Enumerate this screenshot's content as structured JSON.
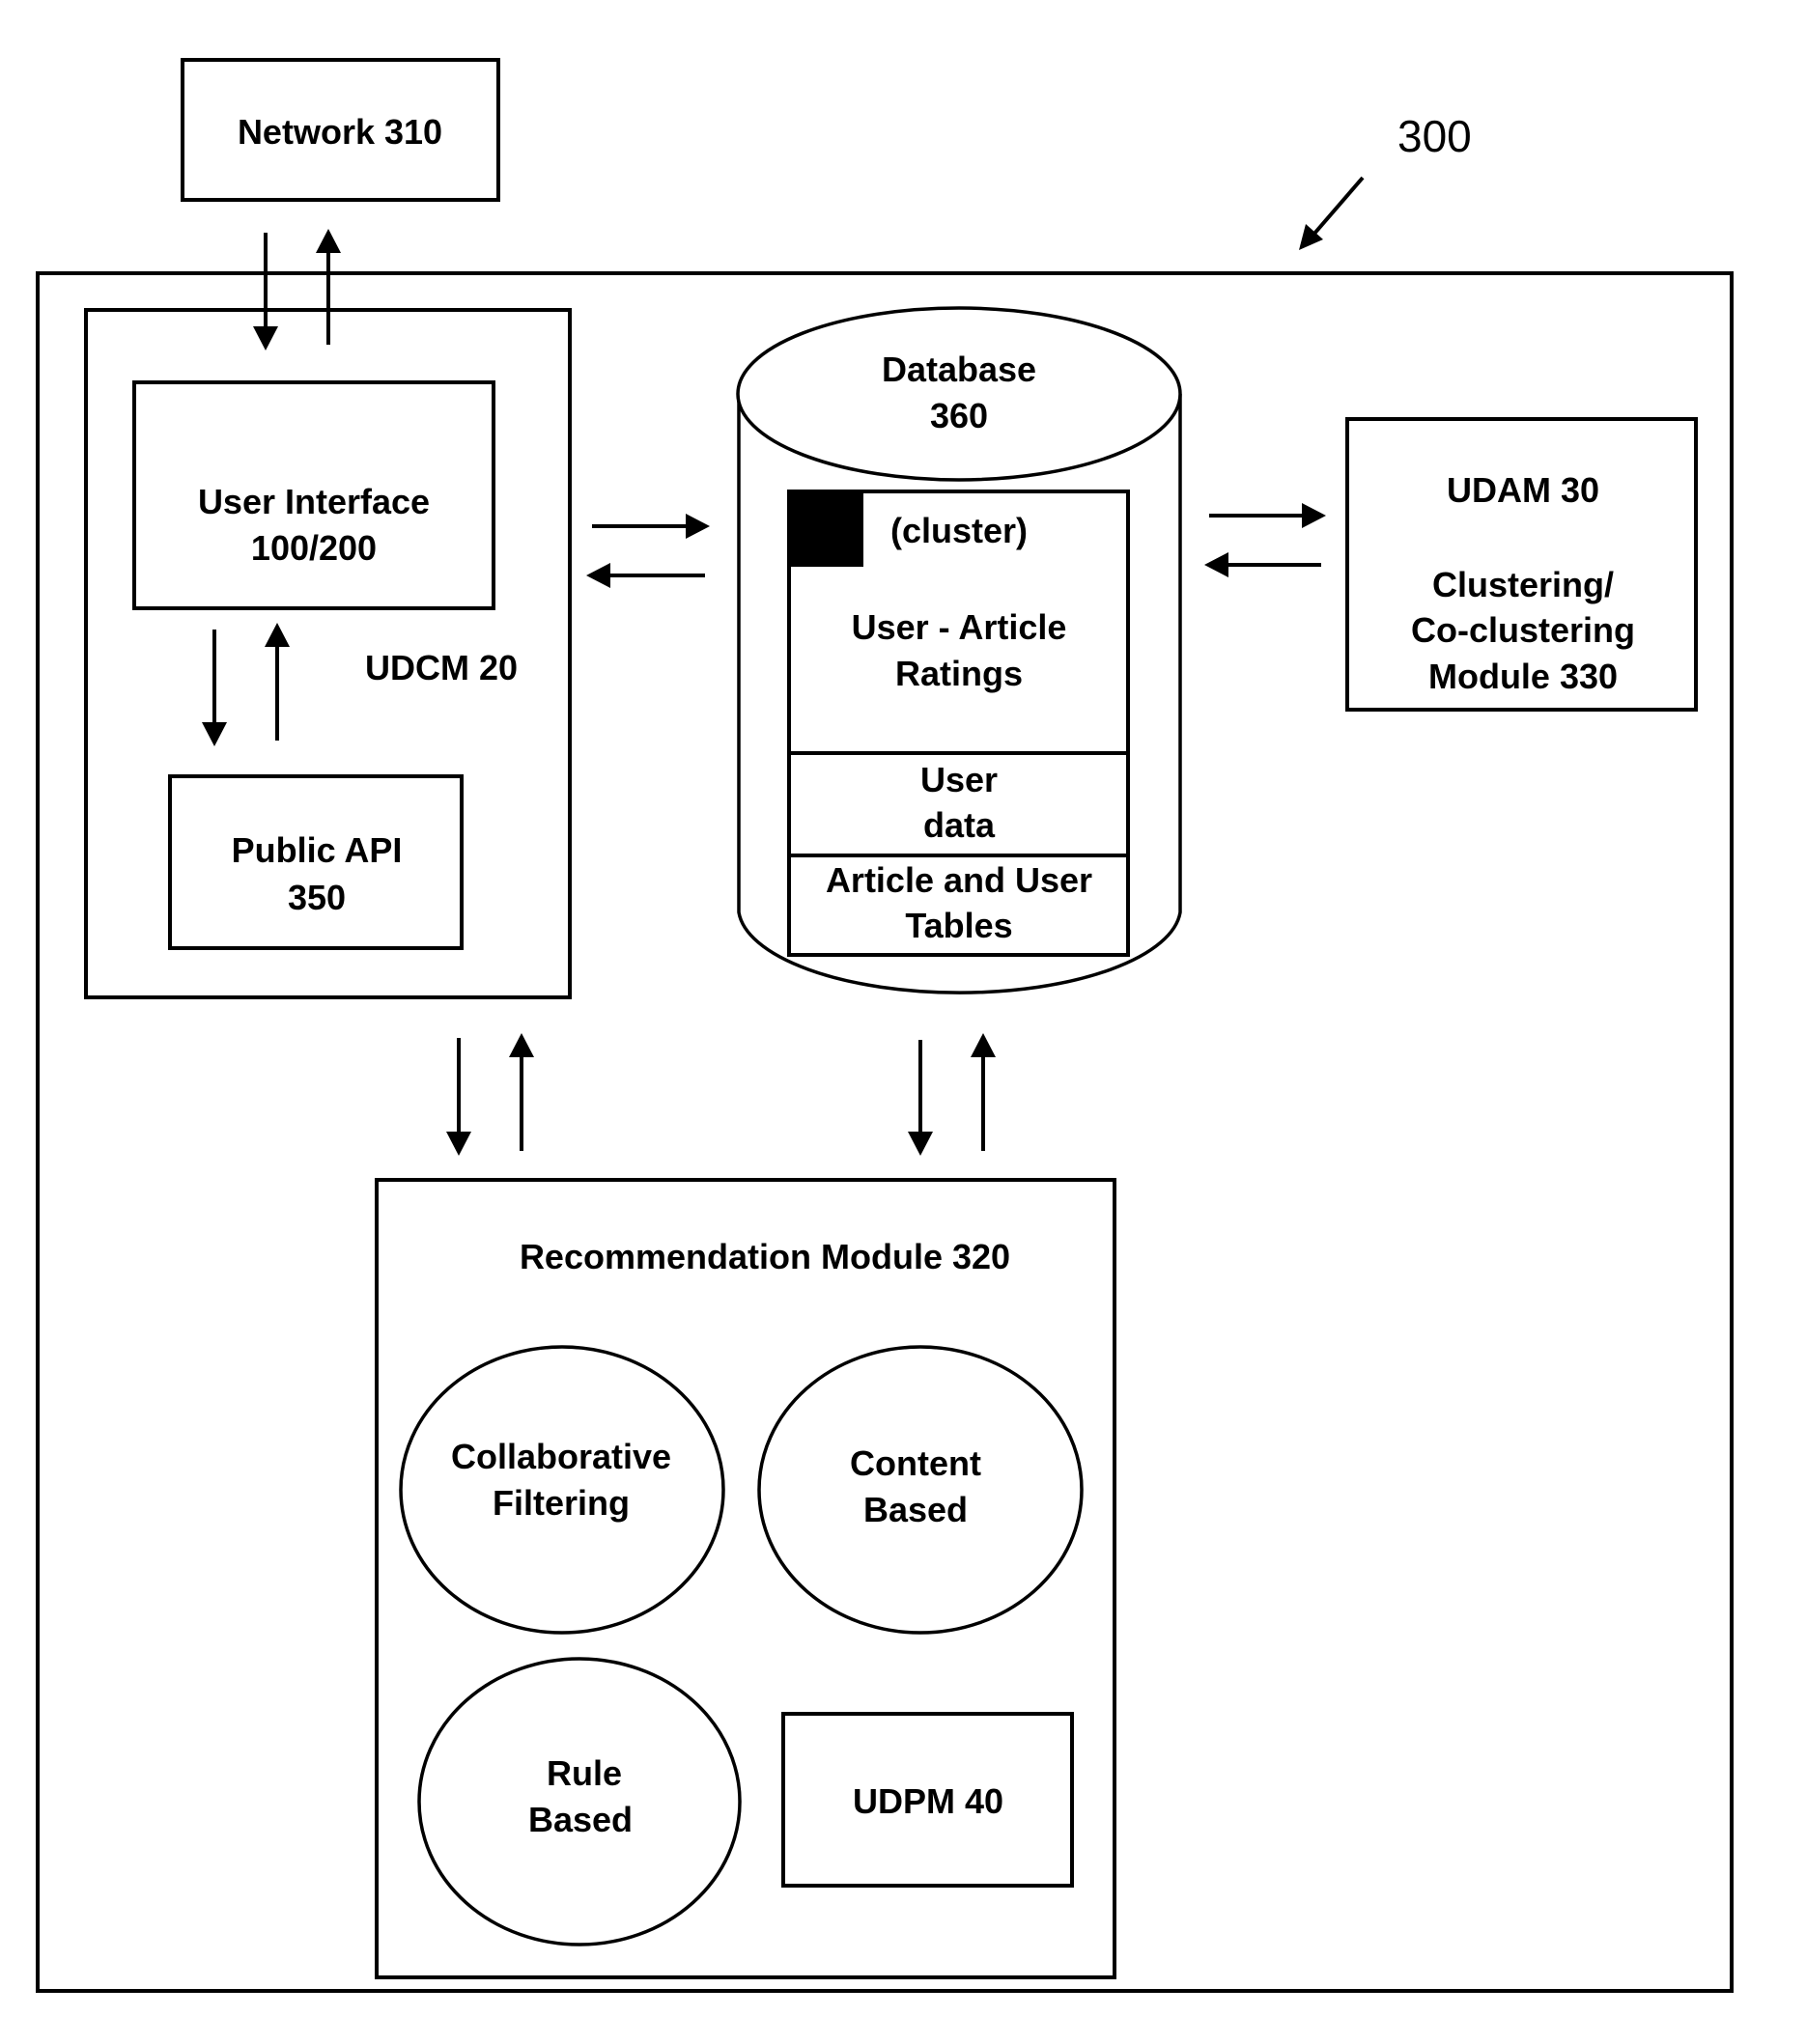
{
  "figure": {
    "reference_label": "300",
    "colors": {
      "ink": "#000000",
      "background": "#ffffff"
    }
  },
  "network": {
    "label": "Network 310"
  },
  "udcm": {
    "label": "UDCM 20",
    "user_interface": {
      "line1": "User Interface",
      "line2": "100/200"
    },
    "public_api": {
      "line1": "Public API",
      "line2": "350"
    }
  },
  "database": {
    "title_line1": "Database",
    "title_line2": "360",
    "cluster_label": "(cluster)",
    "ratings": {
      "line1": "User - Article",
      "line2": "Ratings"
    },
    "user_data": {
      "line1": "User",
      "line2": "data"
    },
    "tables": {
      "line1": "Article and User",
      "line2": "Tables"
    }
  },
  "udam": {
    "line1": "UDAM 30",
    "line2": "Clustering/",
    "line3": "Co-clustering",
    "line4": "Module 330"
  },
  "recommendation": {
    "title": "Recommendation Module 320",
    "collaborative": {
      "line1": "Collaborative",
      "line2": "Filtering"
    },
    "content": {
      "line1": "Content",
      "line2": "Based"
    },
    "rule": {
      "line1": "Rule",
      "line2": "Based"
    },
    "udpm": {
      "label": "UDPM 40"
    }
  },
  "connections": [
    {
      "from": "Network 310",
      "to": "UDCM 20",
      "direction": "bidirectional"
    },
    {
      "from": "User Interface 100/200",
      "to": "Public API 350",
      "direction": "bidirectional"
    },
    {
      "from": "UDCM 20",
      "to": "Database 360",
      "direction": "bidirectional"
    },
    {
      "from": "Database 360",
      "to": "UDAM 30",
      "direction": "bidirectional"
    },
    {
      "from": "UDCM 20",
      "to": "Recommendation Module 320",
      "direction": "bidirectional"
    },
    {
      "from": "Database 360",
      "to": "Recommendation Module 320",
      "direction": "bidirectional"
    }
  ]
}
